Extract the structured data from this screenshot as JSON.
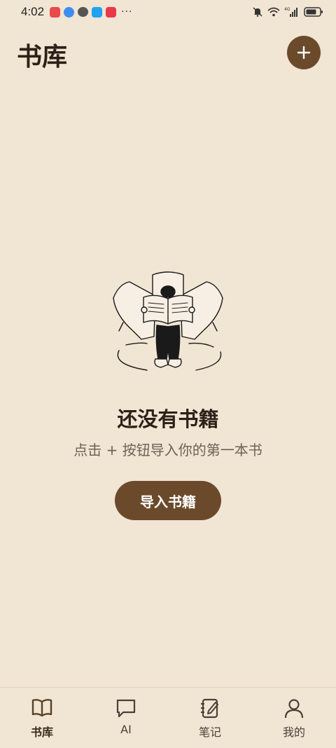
{
  "status_bar": {
    "time": "4:02",
    "more": "···",
    "network": "4G"
  },
  "header": {
    "title": "书库",
    "add_button_label": "+"
  },
  "empty_state": {
    "title": "还没有书籍",
    "hint": "点击 + 按钮导入你的第一本书",
    "import_button_label": "导入书籍"
  },
  "bottom_nav": {
    "items": [
      {
        "label": "书库",
        "icon": "book-open-icon",
        "active": true
      },
      {
        "label": "AI",
        "icon": "chat-bubble-icon",
        "active": false
      },
      {
        "label": "笔记",
        "icon": "notebook-pen-icon",
        "active": false
      },
      {
        "label": "我的",
        "icon": "user-icon",
        "active": false
      }
    ]
  },
  "colors": {
    "background": "#f1e5d3",
    "accent": "#6b4a2b",
    "text": "#2b2118"
  }
}
